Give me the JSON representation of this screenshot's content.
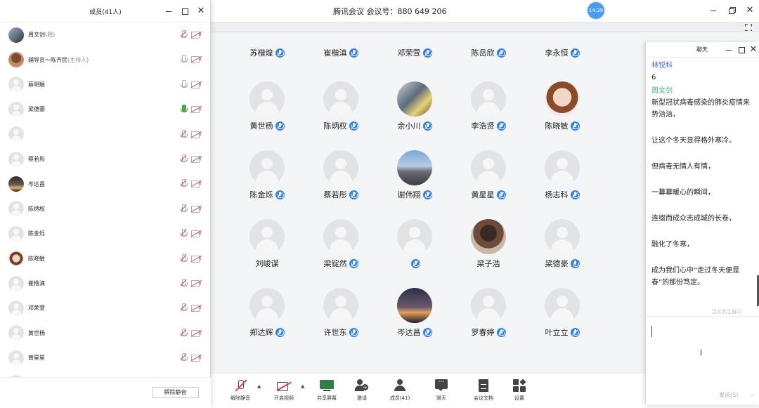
{
  "window": {
    "title": "腾讯会议  会议号：880 649 206",
    "timer": "14:39"
  },
  "grid": [
    {
      "name": "苏楷煌",
      "style": "default",
      "mic": "on"
    },
    {
      "name": "崔楷滇",
      "style": "default",
      "mic": "on"
    },
    {
      "name": "邓荣萱",
      "style": "default",
      "mic": "on"
    },
    {
      "name": "陈岳欣",
      "style": "default",
      "mic": "on"
    },
    {
      "name": "李永恒",
      "style": "default",
      "mic": "on"
    },
    {
      "name": "黄世杨",
      "style": "default",
      "mic": "on"
    },
    {
      "name": "陈炳权",
      "style": "default",
      "mic": "on"
    },
    {
      "name": "余小川",
      "style": "photo-a",
      "mic": "on"
    },
    {
      "name": "李浩贤",
      "style": "default",
      "mic": "on"
    },
    {
      "name": "陈晓敏",
      "style": "photo-b",
      "mic": "on"
    },
    {
      "name": "陈金烁",
      "style": "default",
      "mic": "on"
    },
    {
      "name": "蔡若彤",
      "style": "default",
      "mic": "on"
    },
    {
      "name": "谢伟翔",
      "style": "photo-c",
      "mic": "on"
    },
    {
      "name": "黄星星",
      "style": "default",
      "mic": "on"
    },
    {
      "name": "杨志科",
      "style": "default",
      "mic": "on"
    },
    {
      "name": "刘峻谋",
      "style": "default",
      "mic": "none"
    },
    {
      "name": "梁锭然",
      "style": "default",
      "mic": "on"
    },
    {
      "name": "",
      "style": "default",
      "mic": "on"
    },
    {
      "name": "梁子浩",
      "style": "photo-d",
      "mic": "none"
    },
    {
      "name": "梁德豪",
      "style": "default",
      "mic": "active"
    },
    {
      "name": "郑达辉",
      "style": "default",
      "mic": "on"
    },
    {
      "name": "许世东",
      "style": "default",
      "mic": "on"
    },
    {
      "name": "岑达昌",
      "style": "photo-e",
      "mic": "on"
    },
    {
      "name": "罗春婷",
      "style": "default",
      "mic": "on"
    },
    {
      "name": "叶立立",
      "style": "default",
      "mic": "on"
    }
  ],
  "toolbar": {
    "unmute": "解除静音",
    "video": "开启视频",
    "share": "共享屏幕",
    "invite": "邀请",
    "members": "成员(41)",
    "chat": "聊天",
    "docs": "会议文档",
    "settings": "设置"
  },
  "members_panel": {
    "title": "成员(41人)",
    "unmute_button": "解除静音",
    "rows": [
      {
        "name": "周文剑",
        "role": "(我)",
        "avatar": "p1",
        "mic": "muted"
      },
      {
        "name": "辅导员～陈齐民",
        "role": "(主持人)",
        "avatar": "p2",
        "mic": "off"
      },
      {
        "name": "蔡明颖",
        "role": "",
        "avatar": "",
        "mic": "off"
      },
      {
        "name": "梁德豪",
        "role": "",
        "avatar": "",
        "mic": "on"
      },
      {
        "name": "",
        "role": "",
        "avatar": "",
        "mic": "muted"
      },
      {
        "name": "蔡若彤",
        "role": "",
        "avatar": "",
        "mic": "muted"
      },
      {
        "name": "岑达昌",
        "role": "",
        "avatar": "p3",
        "mic": "muted"
      },
      {
        "name": "陈炳权",
        "role": "",
        "avatar": "",
        "mic": "muted"
      },
      {
        "name": "陈金烁",
        "role": "",
        "avatar": "",
        "mic": "muted"
      },
      {
        "name": "陈晓敏",
        "role": "",
        "avatar": "p4",
        "mic": "muted"
      },
      {
        "name": "崔楷滇",
        "role": "",
        "avatar": "",
        "mic": "muted"
      },
      {
        "name": "邓荣萱",
        "role": "",
        "avatar": "",
        "mic": "muted"
      },
      {
        "name": "黄世杨",
        "role": "",
        "avatar": "",
        "mic": "muted"
      },
      {
        "name": "黄星星",
        "role": "",
        "avatar": "",
        "mic": "muted"
      },
      {
        "name": "",
        "role": "",
        "avatar": "",
        "mic": "muted"
      }
    ]
  },
  "chat_panel": {
    "title": "聊天",
    "sender_1": "林锐科",
    "msg_1": "6",
    "sender_2": "周文剑",
    "lines": [
      "新型冠状病毒感染的肺炎疫情来势汹汹，",
      "让这个冬天显得格外寒冷。",
      "但病毒无情人有情，",
      "一幕幕暖心的瞬间，",
      "连缀而成众志成城的长卷，",
      "融化了冬寒，",
      "成为我们心中“走过冬天便是春”的那份笃定。"
    ],
    "merge_link": "合并到主窗口",
    "send": "发送(S)"
  },
  "colors": {
    "accent": "#2f7fe6",
    "sender_1": "#4f6ad0",
    "sender_2": "#3db36a",
    "muted_red": "#e0393e"
  }
}
